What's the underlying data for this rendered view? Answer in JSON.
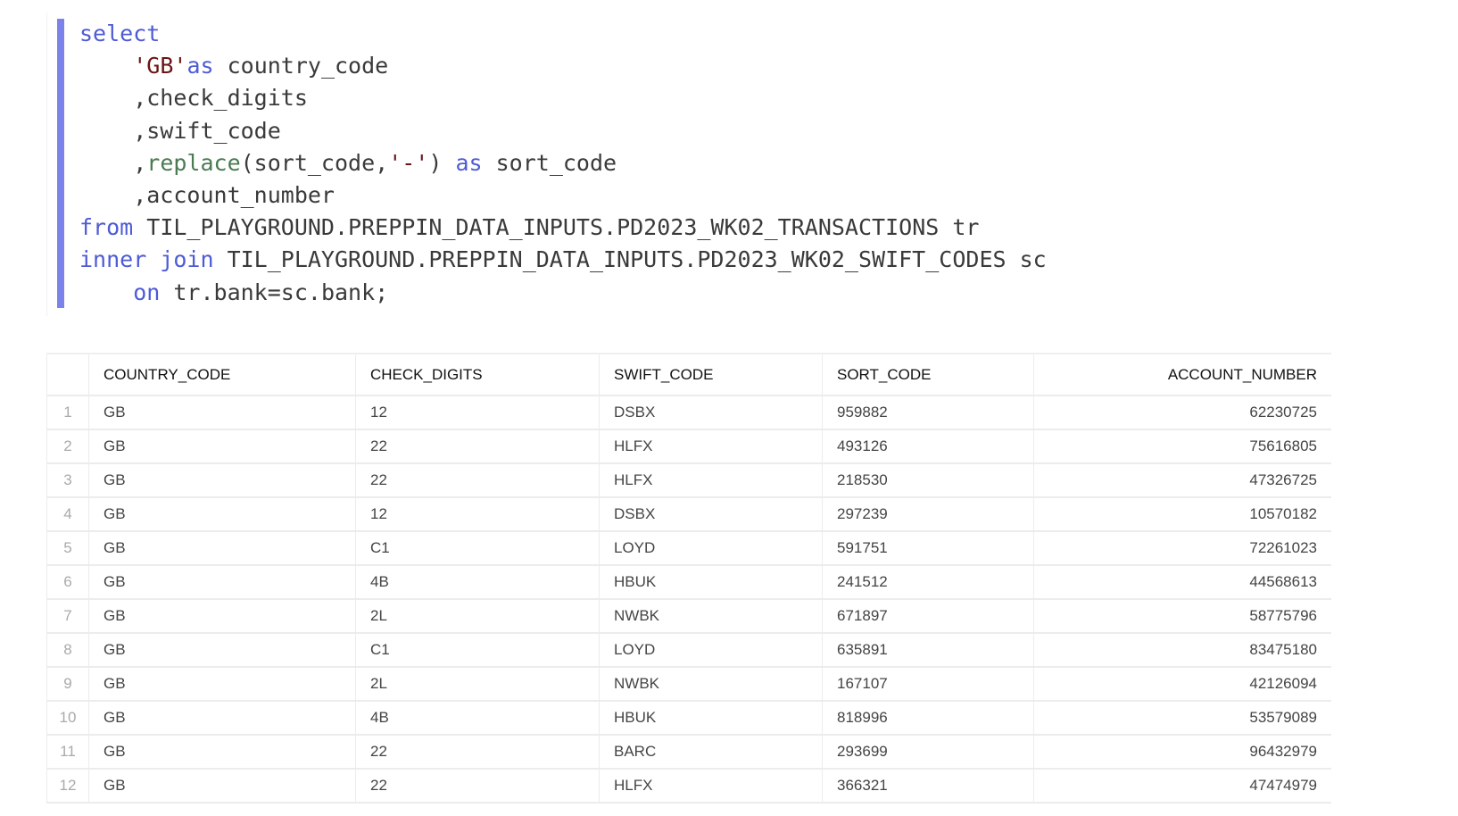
{
  "colors": {
    "keyword": "#4d5bd6",
    "string": "#6b1414",
    "function": "#4a7a52",
    "accent_bar": "#7b83eb"
  },
  "code": [
    [
      {
        "t": "select",
        "c": "kw"
      }
    ],
    [
      {
        "t": "    ",
        "c": "tx"
      },
      {
        "t": "'GB'",
        "c": "str"
      },
      {
        "t": "as",
        "c": "kw"
      },
      {
        "t": " country_code",
        "c": "tx"
      }
    ],
    [
      {
        "t": "    ,check_digits",
        "c": "tx"
      }
    ],
    [
      {
        "t": "    ,swift_code",
        "c": "tx"
      }
    ],
    [
      {
        "t": "    ,",
        "c": "tx"
      },
      {
        "t": "replace",
        "c": "fn"
      },
      {
        "t": "(sort_code,",
        "c": "tx"
      },
      {
        "t": "'-'",
        "c": "str"
      },
      {
        "t": ") ",
        "c": "tx"
      },
      {
        "t": "as",
        "c": "kw"
      },
      {
        "t": " sort_code",
        "c": "tx"
      }
    ],
    [
      {
        "t": "    ,account_number",
        "c": "tx"
      }
    ],
    [
      {
        "t": "from",
        "c": "kw"
      },
      {
        "t": " TIL_PLAYGROUND.PREPPIN_DATA_INPUTS.PD2023_WK02_TRANSACTIONS tr",
        "c": "tx"
      }
    ],
    [
      {
        "t": "inner join",
        "c": "kw"
      },
      {
        "t": " TIL_PLAYGROUND.PREPPIN_DATA_INPUTS.PD2023_WK02_SWIFT_CODES sc",
        "c": "tx"
      }
    ],
    [
      {
        "t": "    ",
        "c": "tx"
      },
      {
        "t": "on",
        "c": "kw"
      },
      {
        "t": " tr.bank=sc.bank;",
        "c": "tx"
      }
    ]
  ],
  "table": {
    "columns": [
      "COUNTRY_CODE",
      "CHECK_DIGITS",
      "SWIFT_CODE",
      "SORT_CODE",
      "ACCOUNT_NUMBER"
    ],
    "rows": [
      [
        "1",
        "GB",
        "12",
        "DSBX",
        "959882",
        "62230725"
      ],
      [
        "2",
        "GB",
        "22",
        "HLFX",
        "493126",
        "75616805"
      ],
      [
        "3",
        "GB",
        "22",
        "HLFX",
        "218530",
        "47326725"
      ],
      [
        "4",
        "GB",
        "12",
        "DSBX",
        "297239",
        "10570182"
      ],
      [
        "5",
        "GB",
        "C1",
        "LOYD",
        "591751",
        "72261023"
      ],
      [
        "6",
        "GB",
        "4B",
        "HBUK",
        "241512",
        "44568613"
      ],
      [
        "7",
        "GB",
        "2L",
        "NWBK",
        "671897",
        "58775796"
      ],
      [
        "8",
        "GB",
        "C1",
        "LOYD",
        "635891",
        "83475180"
      ],
      [
        "9",
        "GB",
        "2L",
        "NWBK",
        "167107",
        "42126094"
      ],
      [
        "10",
        "GB",
        "4B",
        "HBUK",
        "818996",
        "53579089"
      ],
      [
        "11",
        "GB",
        "22",
        "BARC",
        "293699",
        "96432979"
      ],
      [
        "12",
        "GB",
        "22",
        "HLFX",
        "366321",
        "47474979"
      ]
    ]
  }
}
